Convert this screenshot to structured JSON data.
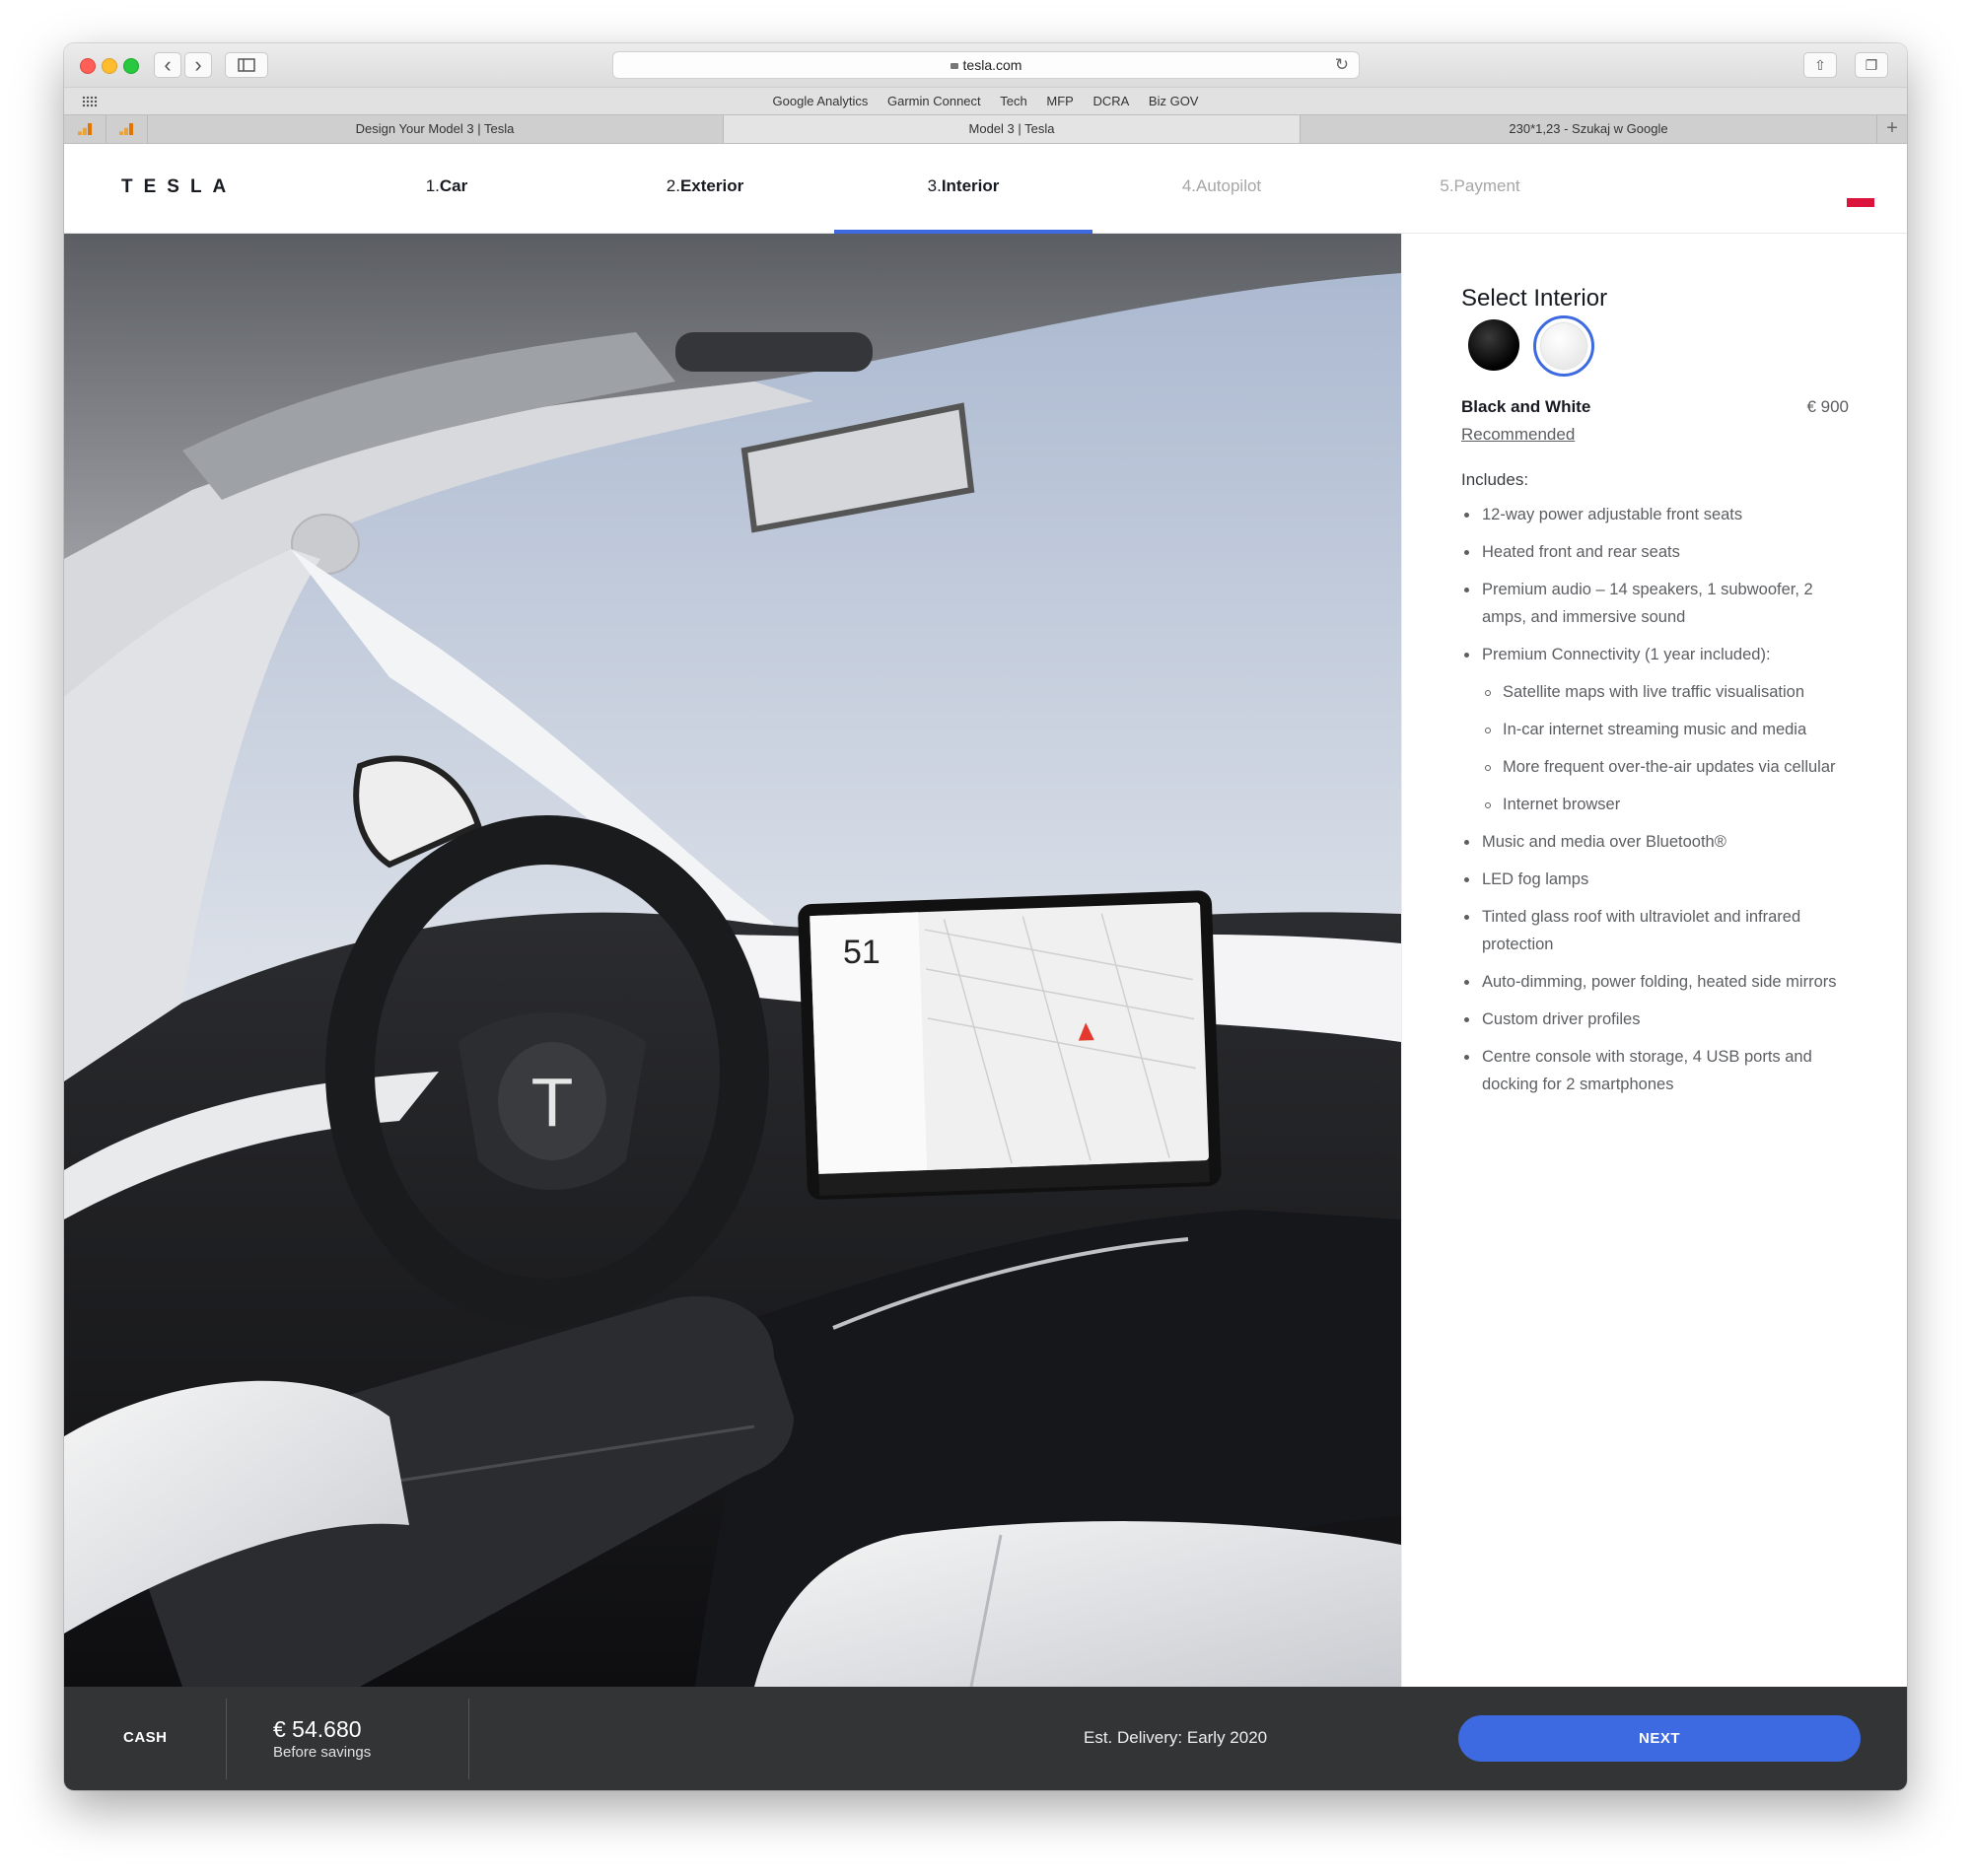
{
  "browser": {
    "url": "tesla.com",
    "bookmarks": [
      "Google Analytics",
      "Garmin Connect",
      "Tech",
      "MFP",
      "DCRA",
      "Biz GOV"
    ],
    "tabs": [
      {
        "title": "Design Your Model 3 | Tesla",
        "active": false
      },
      {
        "title": "Model 3 | Tesla",
        "active": true
      },
      {
        "title": "230*1,23 - Szukaj w Google",
        "active": false
      }
    ],
    "icons": {
      "back": "chevron-left-icon",
      "forward": "chevron-right-icon",
      "sidebar": "sidebar-icon",
      "lock": "lock-icon",
      "reload": "reload-icon",
      "share": "share-icon",
      "tabs": "tabs-icon",
      "new_tab": "plus-icon",
      "grid": "grid-icon",
      "pinned": "analytics-icon"
    }
  },
  "header": {
    "logo": "TESLA",
    "steps": [
      {
        "num": "1.",
        "label": "Car"
      },
      {
        "num": "2.",
        "label": "Exterior"
      },
      {
        "num": "3.",
        "label": "Interior"
      },
      {
        "num": "4.",
        "label": "Autopilot"
      },
      {
        "num": "5.",
        "label": "Payment"
      }
    ],
    "active_step": 3,
    "accent_color": "#3e6ae1"
  },
  "panel": {
    "title": "Select Interior",
    "swatches": [
      {
        "name": "black-interior-swatch",
        "color": "#000000",
        "selected": false
      },
      {
        "name": "white-interior-swatch",
        "color": "#ffffff",
        "selected": true
      }
    ],
    "option_name": "Black and White",
    "option_price": "€ 900",
    "recommended": "Recommended",
    "includes_label": "Includes:",
    "includes": [
      {
        "text": "12-way power adjustable front seats",
        "sub": false
      },
      {
        "text": "Heated front and rear seats",
        "sub": false
      },
      {
        "text": "Premium audio – 14 speakers, 1 subwoofer, 2 amps, and immersive sound",
        "sub": false
      },
      {
        "text": "Premium Connectivity (1 year included):",
        "sub": false
      },
      {
        "text": "Satellite maps with live traffic visualisation",
        "sub": true
      },
      {
        "text": "In-car internet streaming music and media",
        "sub": true
      },
      {
        "text": "More frequent over-the-air updates via cellular",
        "sub": true
      },
      {
        "text": "Internet browser",
        "sub": true
      },
      {
        "text": "Music and media over Bluetooth®",
        "sub": false
      },
      {
        "text": "LED fog lamps",
        "sub": false
      },
      {
        "text": "Tinted glass roof with ultraviolet and infrared protection",
        "sub": false
      },
      {
        "text": "Auto-dimming, power folding, heated side mirrors",
        "sub": false
      },
      {
        "text": "Custom driver profiles",
        "sub": false
      },
      {
        "text": "Centre console with storage, 4 USB ports and docking for 2 smartphones",
        "sub": false
      }
    ]
  },
  "hero": {
    "screen_speed": "51"
  },
  "footer": {
    "payment_type": "CASH",
    "price": "€ 54.680",
    "price_note": "Before savings",
    "delivery": "Est. Delivery: Early 2020",
    "next_label": "NEXT"
  }
}
